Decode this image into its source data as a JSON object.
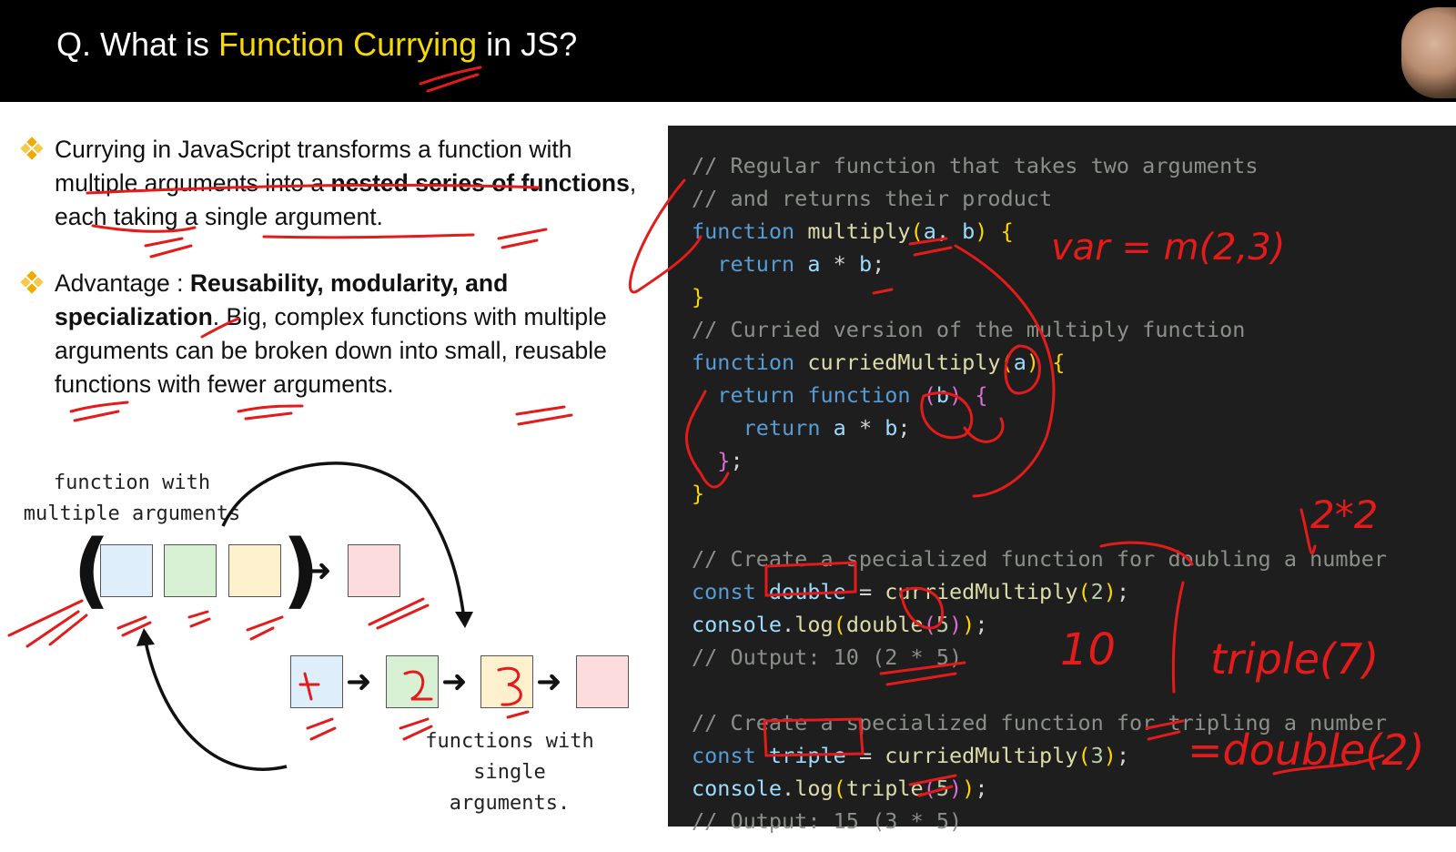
{
  "header": {
    "title_prefix": "Q. What is ",
    "title_highlight": "Function Currying",
    "title_suffix": " in JS?",
    "highlight_color": "#f5d90a"
  },
  "bullets": [
    {
      "parts": [
        "Currying in JavaScript transforms a function with multiple arguments into a ",
        "nested series of functions",
        ", each taking a single argument."
      ]
    },
    {
      "parts": [
        "Advantage : ",
        "Reusability, modularity, and specialization",
        ". Big, complex functions with multiple arguments can be broken down into small, reusable functions with fewer arguments."
      ]
    }
  ],
  "diagram": {
    "label_top": "function with\nmultiple arguments",
    "label_bottom": "functions with single\narguments.",
    "colors": {
      "blue": "#deeefb",
      "green": "#d8f0d4",
      "yellow": "#fdf0cd",
      "pink": "#fcdcdc"
    }
  },
  "code": {
    "comment1": "// Regular function that takes two arguments",
    "comment2": "// and returns their product",
    "comment3": "// Curried version of the multiply function",
    "comment4": "// Create a specialized function for doubling a number",
    "output1": "// Output: 10 (2 * 5)",
    "comment5": "// Create a specialized function for tripling a number",
    "output2": "// Output: 15 (3 * 5)",
    "kw_function": "function",
    "kw_return": "return",
    "kw_const": "const",
    "fn_multiply": "multiply",
    "fn_curried": "curriedMultiply",
    "var_double": "double",
    "var_triple": "triple",
    "console": "console",
    "log": "log",
    "param_a": "a",
    "param_b": "b"
  },
  "annotations": {
    "ink_color": "#e31b1b",
    "note1": "var = m(2,3)",
    "note2": "2*2",
    "note3": "10",
    "note4": "triple(7)",
    "note5": "=double(2)"
  }
}
